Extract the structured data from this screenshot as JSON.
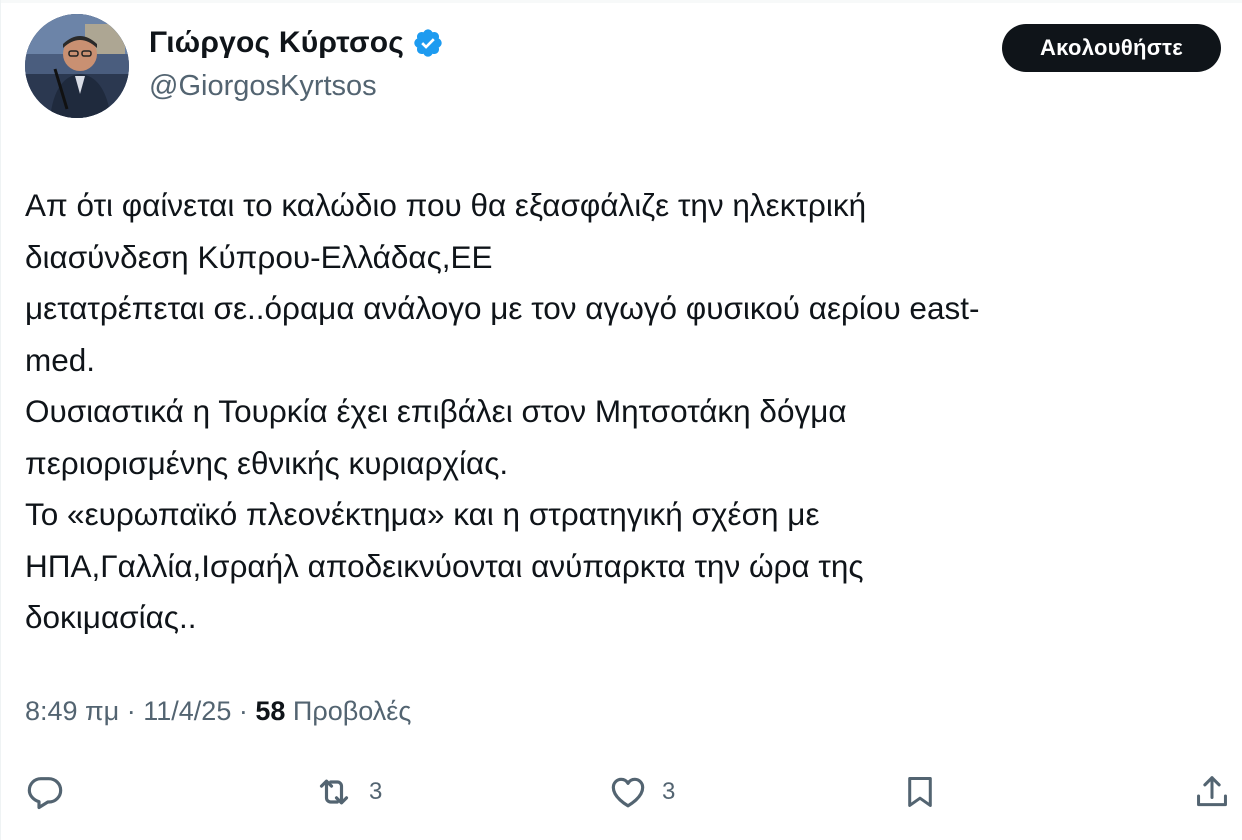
{
  "author": {
    "display_name": "Γιώργος Κύρτσος",
    "handle": "@GiorgosKyrtsos",
    "verified": true,
    "verified_color": "#1d9bf0"
  },
  "follow_button": {
    "label": "Ακολουθήστε"
  },
  "tweet": {
    "lines": [
      "Απ ότι φαίνεται το καλώδιο που θα εξασφάλιζε την ηλεκτρική",
      "διασύνδεση Κύπρου-Ελλάδας,ΕΕ",
      "μετατρέπεται σε..όραμα ανάλογο με τον αγωγό φυσικού αερίου east-",
      "med.",
      "Ουσιαστικά η Τουρκία έχει επιβάλει στον Μητσοτάκη δόγμα",
      "περιορισμένης εθνικής κυριαρχίας.",
      "Το «ευρωπαϊκό πλεονέκτημα» και η στρατηγική σχέση με",
      "ΗΠΑ,Γαλλία,Ισραήλ αποδεικνύονται ανύπαρκτα την ώρα της",
      "δοκιμασίας.."
    ]
  },
  "meta": {
    "time": "8:49 πμ",
    "separator": " · ",
    "date": "11/4/25",
    "views_count": "58",
    "views_label": "Προβολές"
  },
  "actions": {
    "reply_icon": "reply-icon",
    "retweet_icon": "retweet-icon",
    "retweet_count": "3",
    "like_icon": "heart-icon",
    "like_count": "3",
    "bookmark_icon": "bookmark-icon",
    "share_icon": "share-icon"
  },
  "colors": {
    "text_primary": "#0f1419",
    "text_secondary": "#536471",
    "follow_bg": "#0f1419",
    "verified": "#1d9bf0"
  }
}
